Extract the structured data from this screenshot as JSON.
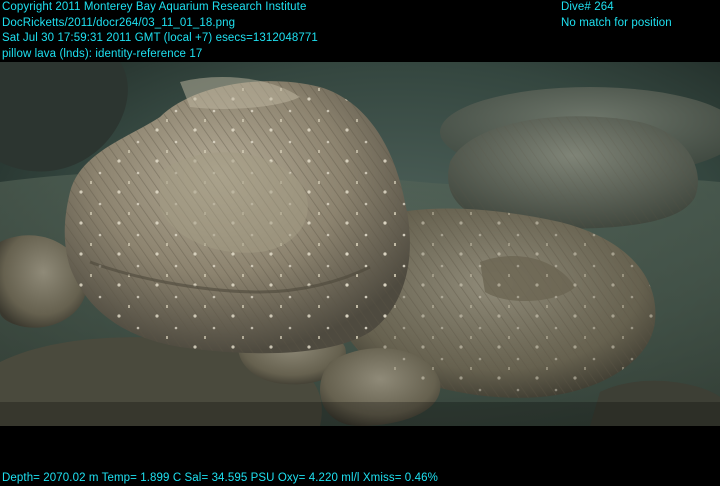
{
  "overlay": {
    "top_left": [
      "Copyright 2011 Monterey Bay Aquarium Research Institute",
      "DocRicketts/2011/docr264/03_11_01_18.png",
      "Sat Jul 30 17:59:31 2011 GMT (local +7)  esecs=1312048771",
      "pillow lava (lnds): identity-reference 17"
    ],
    "top_right": [
      "Dive# 264",
      "No match for position"
    ],
    "bottom": "Depth= 2070.02 m  Temp= 1.899 C  Sal= 34.595 PSU  Oxy= 4.220 ml/l  Xmiss= 0.46%"
  },
  "colors": {
    "overlay_text": "#1ee0f0",
    "background": "#000000",
    "water": "#3a4f4a",
    "rock": "#8a8170"
  }
}
